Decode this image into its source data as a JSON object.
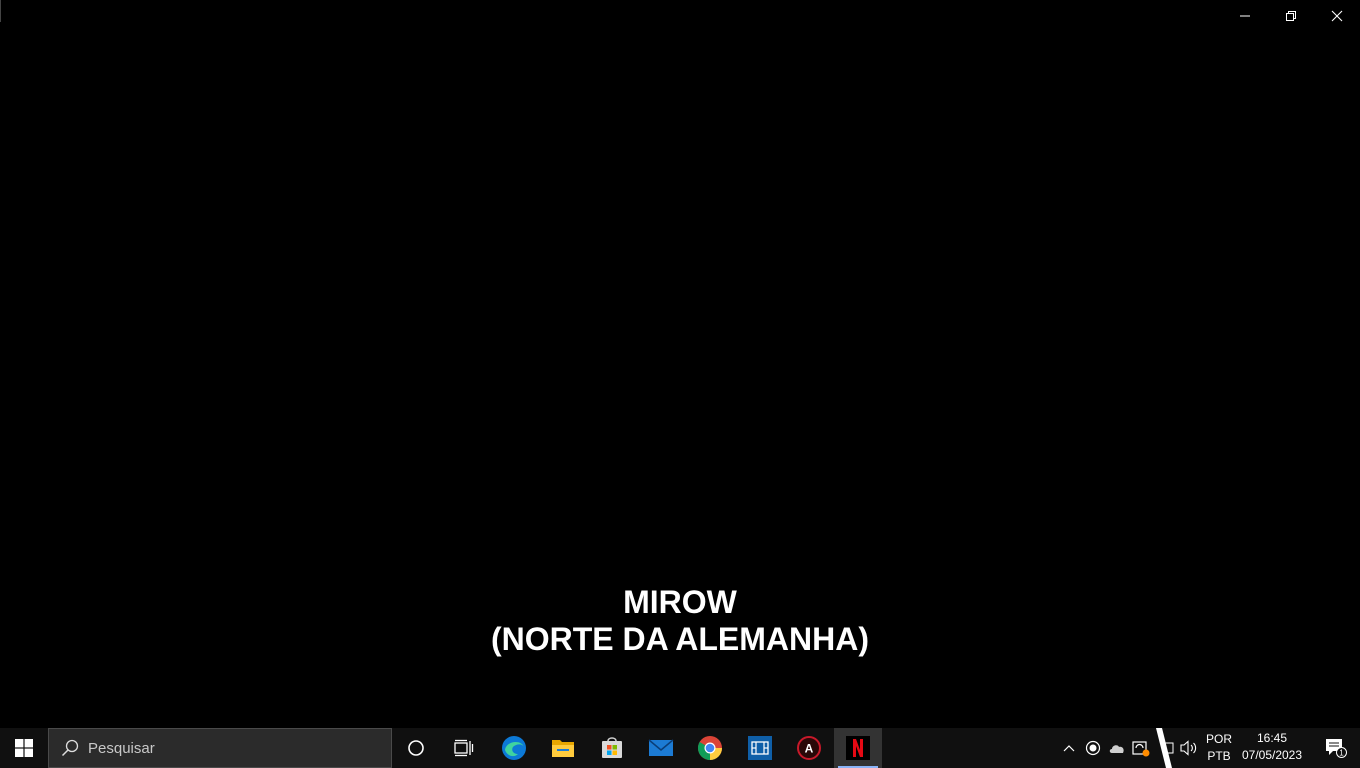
{
  "window": {
    "controls": {
      "minimize": "minimize-icon",
      "restore": "restore-icon",
      "close": "close-icon"
    }
  },
  "subtitle": {
    "line1": "MIROW",
    "line2": "(NORTE DA ALEMANHA)"
  },
  "taskbar": {
    "search_placeholder": "Pesquisar",
    "pinned_apps": [
      "cortana",
      "task-view",
      "edge",
      "file-explorer",
      "microsoft-store",
      "mail",
      "chrome",
      "movies-tv",
      "app-red-a",
      "netflix"
    ],
    "tray": {
      "language_line1": "POR",
      "language_line2": "PTB",
      "time": "16:45",
      "date": "07/05/2023",
      "notification_count": "1"
    }
  },
  "colors": {
    "taskbar_bg": "#101010",
    "search_bg": "#2b2b2b",
    "netflix_red": "#e50914"
  }
}
